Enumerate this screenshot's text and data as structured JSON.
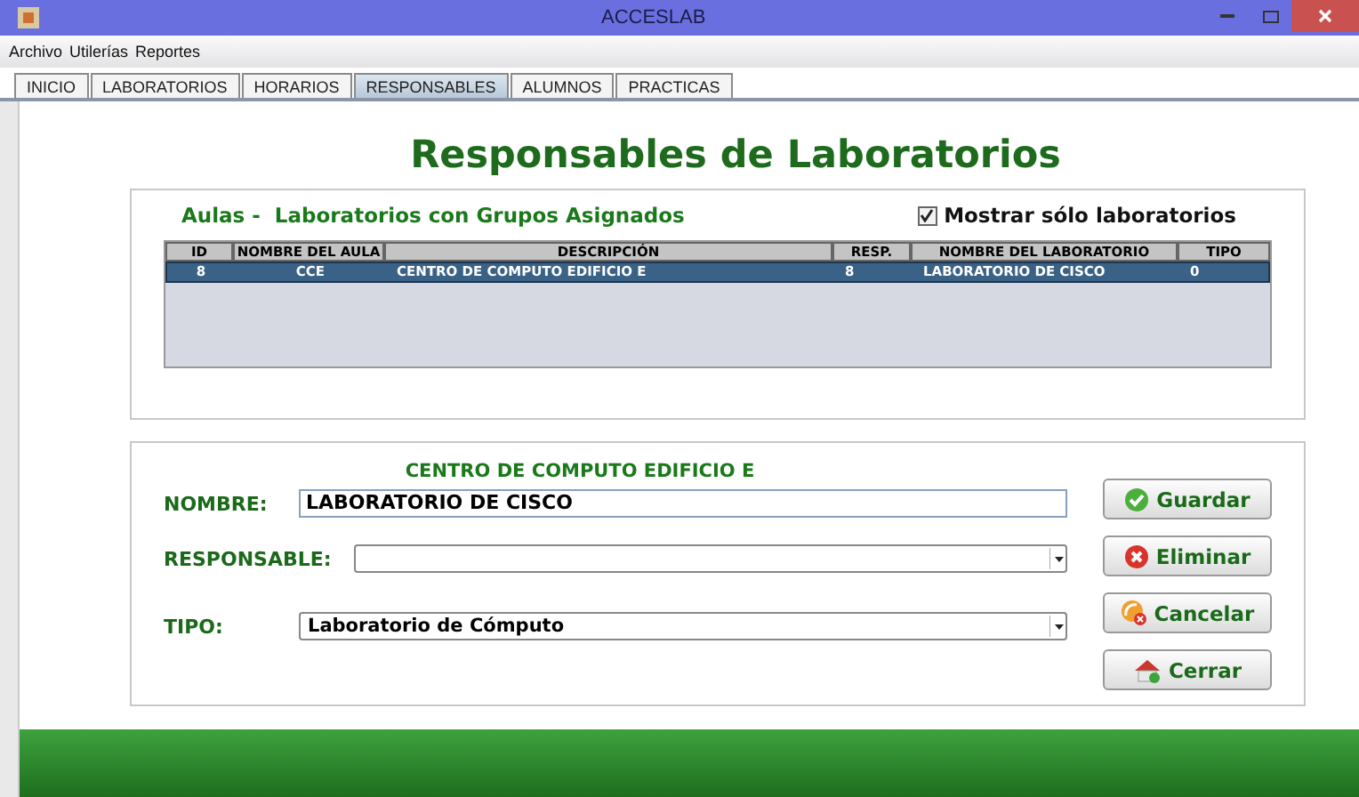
{
  "window": {
    "title": "ACCESLAB"
  },
  "menu": [
    "Archivo",
    "Utilerías",
    "Reportes"
  ],
  "tabs": [
    {
      "label": "INICIO",
      "selected": false
    },
    {
      "label": "LABORATORIOS",
      "selected": false
    },
    {
      "label": "HORARIOS",
      "selected": false
    },
    {
      "label": "RESPONSABLES",
      "selected": true
    },
    {
      "label": "ALUMNOS",
      "selected": false
    },
    {
      "label": "PRACTICAS",
      "selected": false
    }
  ],
  "heading": "Responsables de Laboratorios",
  "list_panel": {
    "title": "Aulas -  Laboratorios con Grupos Asignados",
    "filter": {
      "label": "Mostrar sólo laboratorios",
      "checked": true
    }
  },
  "table": {
    "columns": [
      "ID",
      "NOMBRE DEL AULA",
      "DESCRIPCIÓN",
      "RESP.",
      "NOMBRE DEL LABORATORIO",
      "TIPO"
    ],
    "rows": [
      {
        "cells": [
          "8",
          "CCE",
          "CENTRO DE COMPUTO EDIFICIO E",
          "8",
          "LABORATORIO DE CISCO",
          "0"
        ],
        "selected": true
      }
    ]
  },
  "form": {
    "caption": "CENTRO DE COMPUTO EDIFICIO E",
    "fields": [
      {
        "kind": "text",
        "label": "NOMBRE:",
        "value": "LABORATORIO DE CISCO"
      },
      {
        "kind": "select",
        "label": "RESPONSABLE:"
      },
      {
        "kind": "select",
        "label": "TIPO:",
        "value": "Laboratorio de Cómputo"
      }
    ],
    "buttons": [
      {
        "kind": "save",
        "label": "Guardar"
      },
      {
        "kind": "delete",
        "label": "Eliminar"
      },
      {
        "kind": "cancel",
        "label": "Cancelar"
      },
      {
        "kind": "close",
        "label": "Cerrar"
      }
    ]
  }
}
